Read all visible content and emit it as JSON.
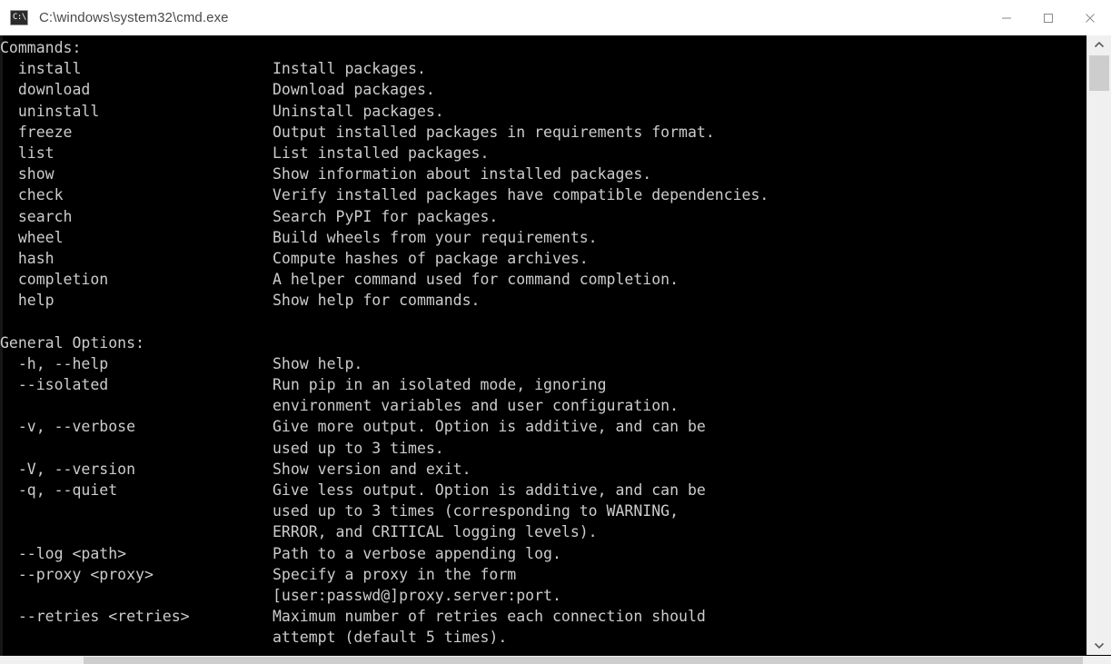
{
  "window": {
    "title": "C:\\windows\\system32\\cmd.exe",
    "icon": "cmd-icon",
    "icon_glyph": "C:\\",
    "background_color": "#000000",
    "titlebar_color": "#ffffff",
    "text_color": "#cccccc"
  },
  "titlebar": {
    "minimize_label": "minimize-icon",
    "maximize_label": "maximize-icon",
    "close_label": "close-icon"
  },
  "scrollbar": {
    "vertical": {
      "up_arrow": "chevron-up-icon",
      "down_arrow": "chevron-down-icon",
      "thumb_position_percent": 3
    },
    "horizontal": {
      "thumb_position_percent": 8
    }
  },
  "console": {
    "lines": [
      {
        "a": "Commands:",
        "b": ""
      },
      {
        "a": "  install",
        "b": "Install packages."
      },
      {
        "a": "  download",
        "b": "Download packages."
      },
      {
        "a": "  uninstall",
        "b": "Uninstall packages."
      },
      {
        "a": "  freeze",
        "b": "Output installed packages in requirements format."
      },
      {
        "a": "  list",
        "b": "List installed packages."
      },
      {
        "a": "  show",
        "b": "Show information about installed packages."
      },
      {
        "a": "  check",
        "b": "Verify installed packages have compatible dependencies."
      },
      {
        "a": "  search",
        "b": "Search PyPI for packages."
      },
      {
        "a": "  wheel",
        "b": "Build wheels from your requirements."
      },
      {
        "a": "  hash",
        "b": "Compute hashes of package archives."
      },
      {
        "a": "  completion",
        "b": "A helper command used for command completion."
      },
      {
        "a": "  help",
        "b": "Show help for commands."
      },
      {
        "a": "",
        "b": ""
      },
      {
        "a": "General Options:",
        "b": ""
      },
      {
        "a": "  -h, --help",
        "b": "Show help."
      },
      {
        "a": "  --isolated",
        "b": "Run pip in an isolated mode, ignoring"
      },
      {
        "a": "",
        "b": "environment variables and user configuration."
      },
      {
        "a": "  -v, --verbose",
        "b": "Give more output. Option is additive, and can be"
      },
      {
        "a": "",
        "b": "used up to 3 times."
      },
      {
        "a": "  -V, --version",
        "b": "Show version and exit."
      },
      {
        "a": "  -q, --quiet",
        "b": "Give less output. Option is additive, and can be"
      },
      {
        "a": "",
        "b": "used up to 3 times (corresponding to WARNING,"
      },
      {
        "a": "",
        "b": "ERROR, and CRITICAL logging levels)."
      },
      {
        "a": "  --log <path>",
        "b": "Path to a verbose appending log."
      },
      {
        "a": "  --proxy <proxy>",
        "b": "Specify a proxy in the form"
      },
      {
        "a": "",
        "b": "[user:passwd@]proxy.server:port."
      },
      {
        "a": "  --retries <retries>",
        "b": "Maximum number of retries each connection should"
      },
      {
        "a": "",
        "b": "attempt (default 5 times)."
      }
    ]
  }
}
